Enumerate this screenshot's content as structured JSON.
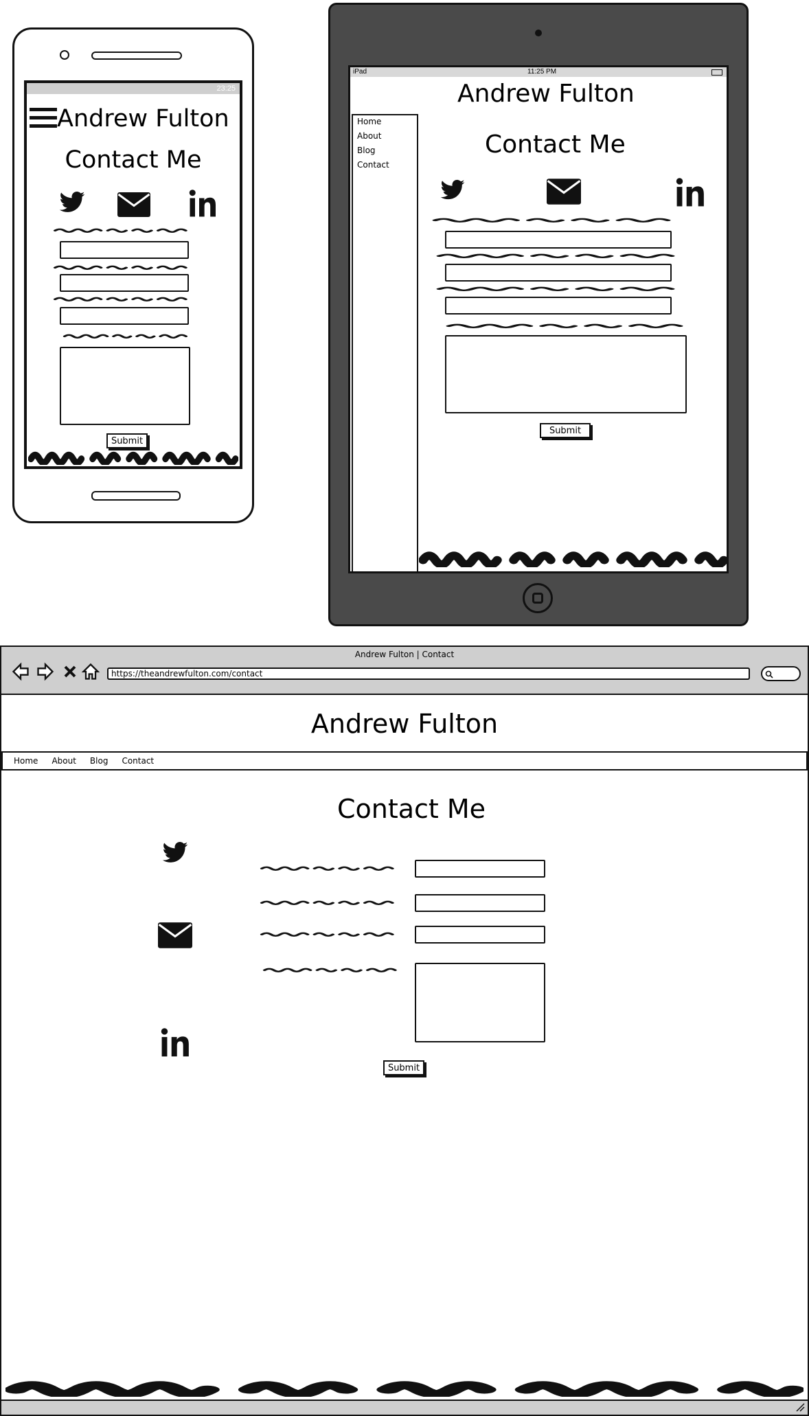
{
  "site_title": "Andrew Fulton",
  "page_heading": "Contact Me",
  "submit_label": "Submit",
  "nav_items": [
    "Home",
    "About",
    "Blog",
    "Contact"
  ],
  "phone": {
    "status_time": "23:25"
  },
  "tablet": {
    "status_device": "iPad",
    "status_time": "11:25 PM"
  },
  "browser": {
    "window_title": "Andrew Fulton | Contact",
    "url": "https://theandrewfulton.com/contact"
  },
  "icons": [
    "twitter-icon",
    "email-icon",
    "linkedin-icon",
    "hamburger-menu-icon",
    "back-icon",
    "forward-icon",
    "stop-icon",
    "home-icon",
    "search-icon"
  ]
}
